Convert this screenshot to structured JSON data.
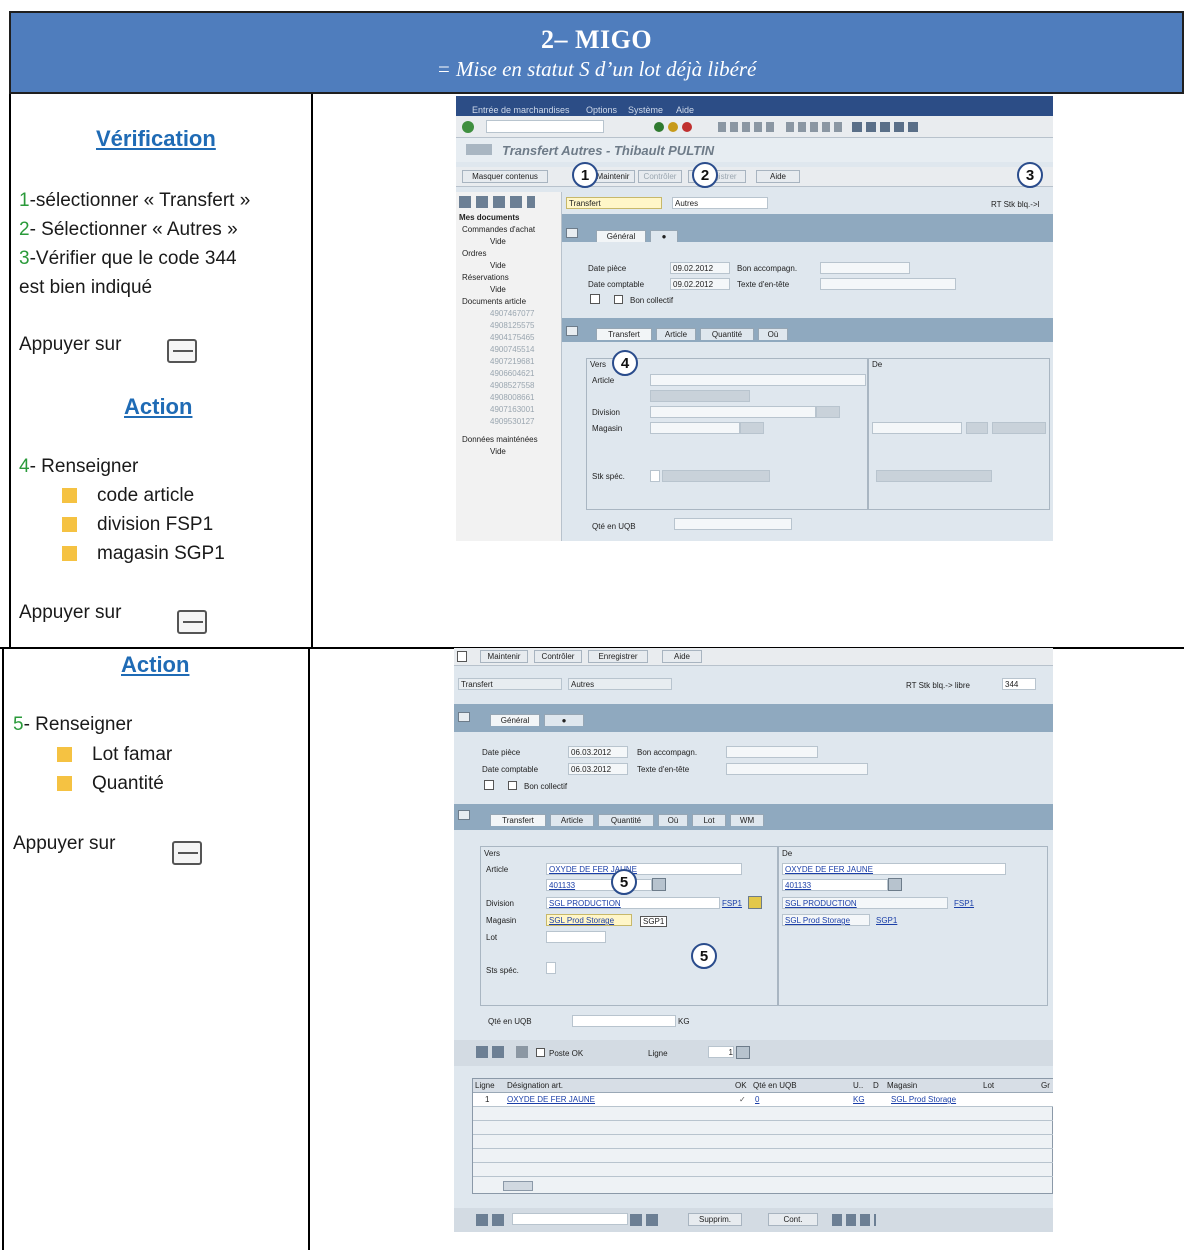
{
  "header": {
    "title": "2– MIGO",
    "subtitle": "= Mise en statut S d’un lot déjà libéré"
  },
  "left_top": {
    "heading1": "Vérification",
    "steps": [
      {
        "num": "1",
        "text": "-sélectionner « Transfert »"
      },
      {
        "num": "2",
        "text": "- Sélectionner « Autres »"
      },
      {
        "num": "3",
        "text": "-Vérifier que le code 344"
      }
    ],
    "step3_cont": "est bien indiqué",
    "press1": "Appuyer sur",
    "heading2": "Action",
    "step4_num": "4",
    "step4_text": "- Renseigner",
    "bullets": [
      "code article",
      "division FSP1",
      "magasin SGP1"
    ],
    "press2": "Appuyer sur"
  },
  "left_bottom": {
    "heading": "Action",
    "step5_num": "5",
    "step5_text": "- Renseigner",
    "bullets": [
      "Lot famar",
      "Quantité"
    ],
    "press": "Appuyer sur"
  },
  "sap1": {
    "menu": [
      "Entrée de marchandises",
      "Options",
      "Système",
      "Aide"
    ],
    "title": "Transfert Autres - Thibault PULTIN",
    "toolbar": [
      "Masquer contenus",
      "Maintenir",
      "Contrôler",
      "Enregistrer",
      "Aide"
    ],
    "action": "Transfert",
    "subaction": "Autres",
    "mvt_label": "RT Stk blq.->l",
    "nav": {
      "title": "Mes documents",
      "groups": [
        {
          "name": "Commandes d'achat",
          "items": [
            "Vide"
          ]
        },
        {
          "name": "Ordres",
          "items": [
            "Vide"
          ]
        },
        {
          "name": "Réservations",
          "items": [
            "Vide"
          ]
        },
        {
          "name": "Documents article",
          "items": [
            "4907467077",
            "4908125575",
            "4904175465",
            "4900745514",
            "4907219681",
            "4906604621",
            "4908527558",
            "4908008661",
            "4907163001",
            "4909530127"
          ]
        },
        {
          "name": "Données mainténées",
          "items": [
            "Vide"
          ]
        }
      ]
    },
    "tabs_top": [
      "Général"
    ],
    "date_piece_label": "Date pièce",
    "date_piece": "09.02.2012",
    "date_compta_label": "Date comptable",
    "date_compta": "09.02.2012",
    "bon_label": "Bon accompagn.",
    "texte_label": "Texte d'en-tête",
    "collectif": "Bon collectif",
    "tabs_bottom": [
      "Transfert",
      "Article",
      "Quantité",
      "Où"
    ],
    "vers": "Vers",
    "de": "De",
    "article": "Article",
    "division": "Division",
    "magasin": "Magasin",
    "stk": "Stk spéc.",
    "qte": "Qté en UQB"
  },
  "sap2": {
    "toolbar": [
      "Maintenir",
      "Contrôler",
      "Enregistrer",
      "Aide"
    ],
    "action": "Transfert",
    "subaction": "Autres",
    "mvt_label": "RT Stk blq.-> libre",
    "mvt_code": "344",
    "tabs_top": [
      "Général"
    ],
    "date_piece_label": "Date pièce",
    "date_piece": "06.03.2012",
    "date_compta_label": "Date comptable",
    "date_compta": "06.03.2012",
    "bon_label": "Bon accompagn.",
    "texte_label": "Texte d'en-tête",
    "collectif": "Bon collectif",
    "tabs_bottom": [
      "Transfert",
      "Article",
      "Quantité",
      "Où",
      "Lot",
      "WM"
    ],
    "vers": "Vers",
    "de": "De",
    "article_label": "Article",
    "article_name": "OXYDE DE FER JAUNE",
    "article_code": "401133",
    "division_label": "Division",
    "division_name": "SGL PRODUCTION",
    "division_code": "FSP1",
    "magasin_label": "Magasin",
    "magasin_name": "SGL Prod Storage",
    "magasin_code": "SGP1",
    "lot_label": "Lot",
    "stk_label": "Sts spéc.",
    "de_article": "OXYDE DE FER JAUNE",
    "de_code": "401133",
    "de_division": "SGL PRODUCTION",
    "de_div_code": "FSP1",
    "de_magasin": "SGL Prod Storage",
    "de_mag_code": "SGP1",
    "qte_label": "Qté en UQB",
    "qte_unit": "KG",
    "poste_ok": "Poste OK",
    "ligne_label": "Ligne",
    "ligne_val": "1",
    "grid_headers": [
      "Ligne",
      "Désignation art.",
      "OK",
      "Qté en UQB",
      "U..",
      "D",
      "Magasin",
      "Lot",
      "Gr"
    ],
    "grid_row": {
      "ligne": "1",
      "designation": "OXYDE DE FER JAUNE",
      "qte": "0",
      "unit": "KG",
      "magasin": "SGL Prod Storage"
    },
    "bottom": [
      "Supprim.",
      "Cont."
    ]
  },
  "callouts": {
    "c1": "1",
    "c2": "2",
    "c3": "3",
    "c4": "4",
    "c5a": "5",
    "c5b": "5"
  }
}
